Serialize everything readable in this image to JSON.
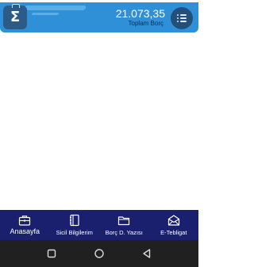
{
  "header": {
    "total_amount": "21.073,35",
    "total_label": "Toplam Borç",
    "logo_icon": "sigma-briefcase-icon",
    "menu_icon": "list-menu-icon",
    "colors": {
      "header_bg": "#2f8fd7",
      "label": "#0c2d55",
      "button_bg": "#234f7b"
    }
  },
  "bottom_nav": {
    "items": [
      {
        "label": "Anasayfa",
        "icon": "briefcase-icon",
        "active": true
      },
      {
        "label": "Sicil Bilgilerim",
        "icon": "notebook-icon",
        "active": false
      },
      {
        "label": "Borç D. Yazısı",
        "icon": "folder-icon",
        "active": false
      },
      {
        "label": "E-Tebligat",
        "icon": "envelope-icon",
        "active": false
      }
    ],
    "bg_color": "#1a1f6e"
  },
  "system_bar": {
    "buttons": [
      "recents-square-icon",
      "home-circle-icon",
      "back-triangle-icon"
    ],
    "bg_color": "#202020"
  }
}
